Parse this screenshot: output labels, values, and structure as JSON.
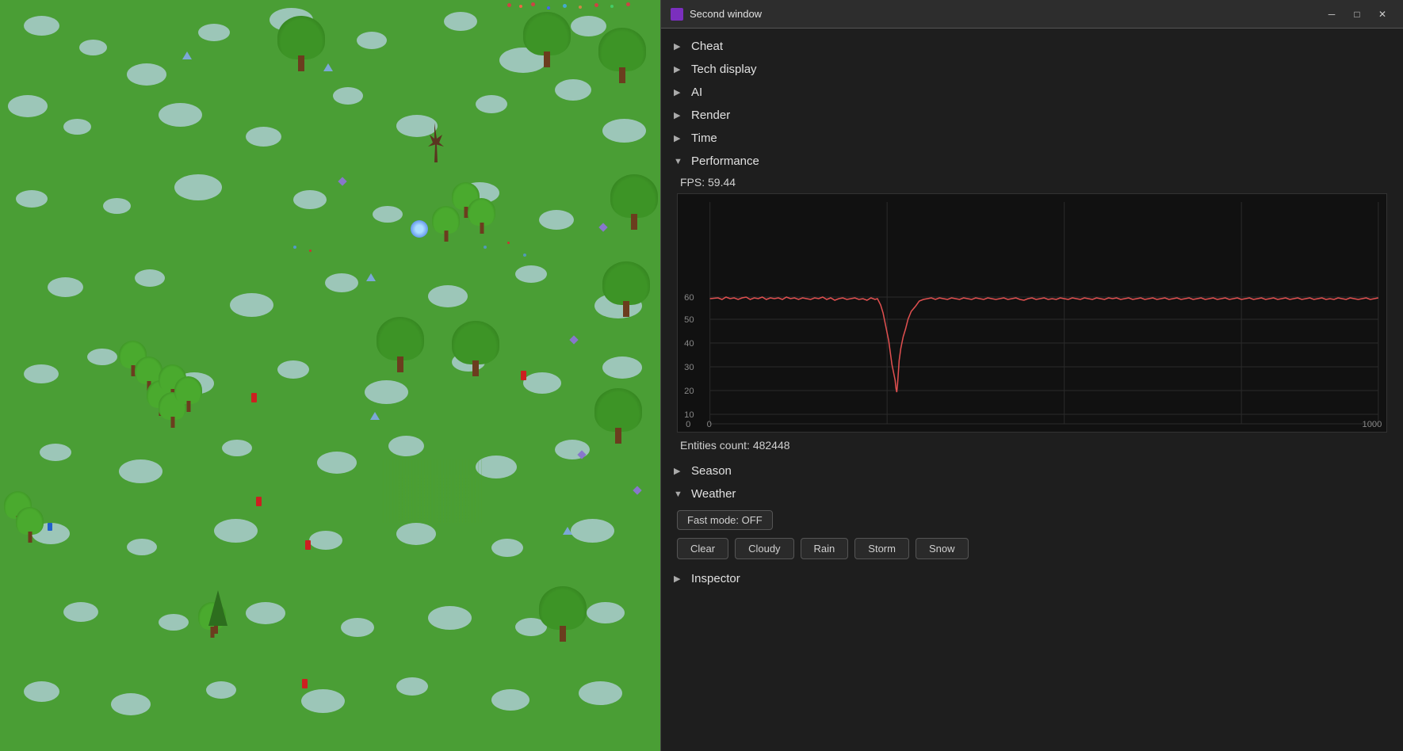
{
  "titleBar": {
    "title": "Second window",
    "minimize": "─",
    "maximize": "□",
    "close": "✕"
  },
  "menu": {
    "items": [
      {
        "id": "cheat",
        "label": "Cheat",
        "arrow": "▶",
        "expanded": false
      },
      {
        "id": "tech-display",
        "label": "Tech display",
        "arrow": "▶",
        "expanded": false
      },
      {
        "id": "ai",
        "label": "AI",
        "arrow": "▶",
        "expanded": false
      },
      {
        "id": "render",
        "label": "Render",
        "arrow": "▶",
        "expanded": false
      },
      {
        "id": "time",
        "label": "Time",
        "arrow": "▶",
        "expanded": false
      },
      {
        "id": "performance",
        "label": "Performance",
        "arrow": "▼",
        "expanded": true
      },
      {
        "id": "season",
        "label": "Season",
        "arrow": "▶",
        "expanded": false
      },
      {
        "id": "weather",
        "label": "Weather",
        "arrow": "▼",
        "expanded": true
      }
    ]
  },
  "performance": {
    "fps_label": "FPS: 59.44",
    "entities_label": "Entities count: 482448",
    "chart": {
      "y_max": 60,
      "y_labels": [
        "60",
        "50",
        "40",
        "30",
        "20",
        "10",
        "0"
      ],
      "x_labels": [
        "0",
        "1000"
      ],
      "grid_lines_y": [
        60,
        50,
        40,
        30,
        20,
        10,
        0
      ],
      "accent_color": "#e05050"
    }
  },
  "weather": {
    "fast_mode_label": "Fast mode: OFF",
    "buttons": [
      {
        "id": "clear",
        "label": "Clear"
      },
      {
        "id": "cloudy",
        "label": "Cloudy"
      },
      {
        "id": "rain",
        "label": "Rain"
      },
      {
        "id": "storm",
        "label": "Storm"
      },
      {
        "id": "snow",
        "label": "Snow"
      }
    ]
  },
  "inspector": {
    "label": "Inspector"
  },
  "colors": {
    "bg": "#1e1e1e",
    "panel_bg": "#2d2d2d",
    "accent": "#7b2fbe",
    "text": "#e0e0e0",
    "fps_line": "#e05050"
  }
}
